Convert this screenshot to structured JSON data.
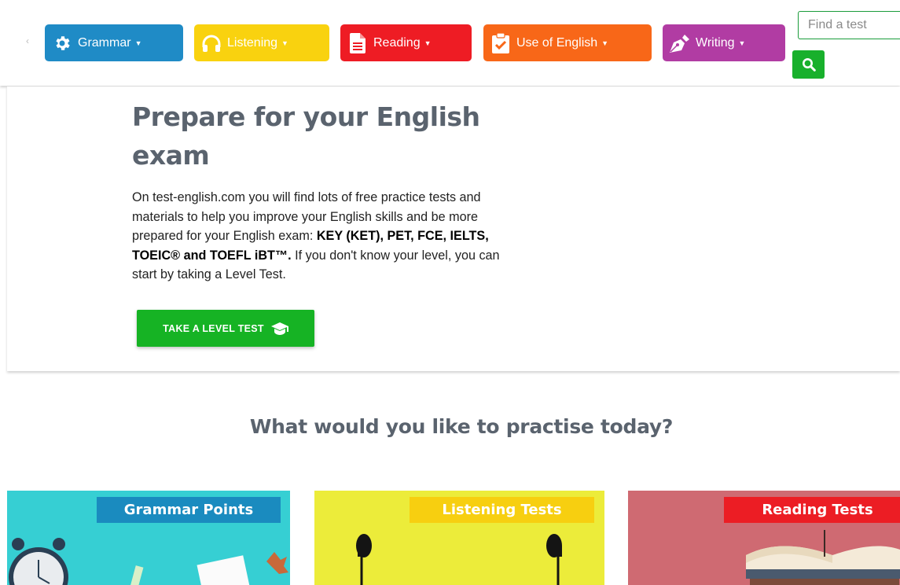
{
  "nav": {
    "items": [
      {
        "label": "Grammar",
        "color": "#1f8bc6",
        "text_color": "#ffffff",
        "icon": "gear-icon"
      },
      {
        "label": "Listening",
        "color": "#f9d20f",
        "text_color": "#ffffff",
        "icon": "headphones-icon"
      },
      {
        "label": "Reading",
        "color": "#ee1c24",
        "text_color": "#ffffff",
        "icon": "document-icon"
      },
      {
        "label": "Use of English",
        "color": "#f86718",
        "text_color": "#ffffff",
        "icon": "clipboard-check-icon"
      },
      {
        "label": "Writing",
        "color": "#b13ca3",
        "text_color": "#ffffff",
        "icon": "pen-nib-icon"
      }
    ]
  },
  "search": {
    "placeholder": "Find a test",
    "button_color": "#18b02c",
    "icon": "search-icon"
  },
  "hero": {
    "title": "Prepare for your English exam",
    "intro": "On test-english.com you will find lots of free practice tests and materials to help you improve your English skills and be more prepared for your English exam: ",
    "exams": "KEY (KET), PET, FCE, IELTS, TOEIC® and TOEFL iBT™.",
    "outro": " If you don't know your level, you can start by taking a Level Test.",
    "cta_label": "TAKE A LEVEL TEST",
    "cta_icon": "graduation-cap-icon",
    "cta_color": "#16b324"
  },
  "practise": {
    "heading": "What would you like to practise today?",
    "cards": [
      {
        "label": "Grammar Points"
      },
      {
        "label": "Listening Tests"
      },
      {
        "label": "Reading Tests"
      }
    ]
  }
}
